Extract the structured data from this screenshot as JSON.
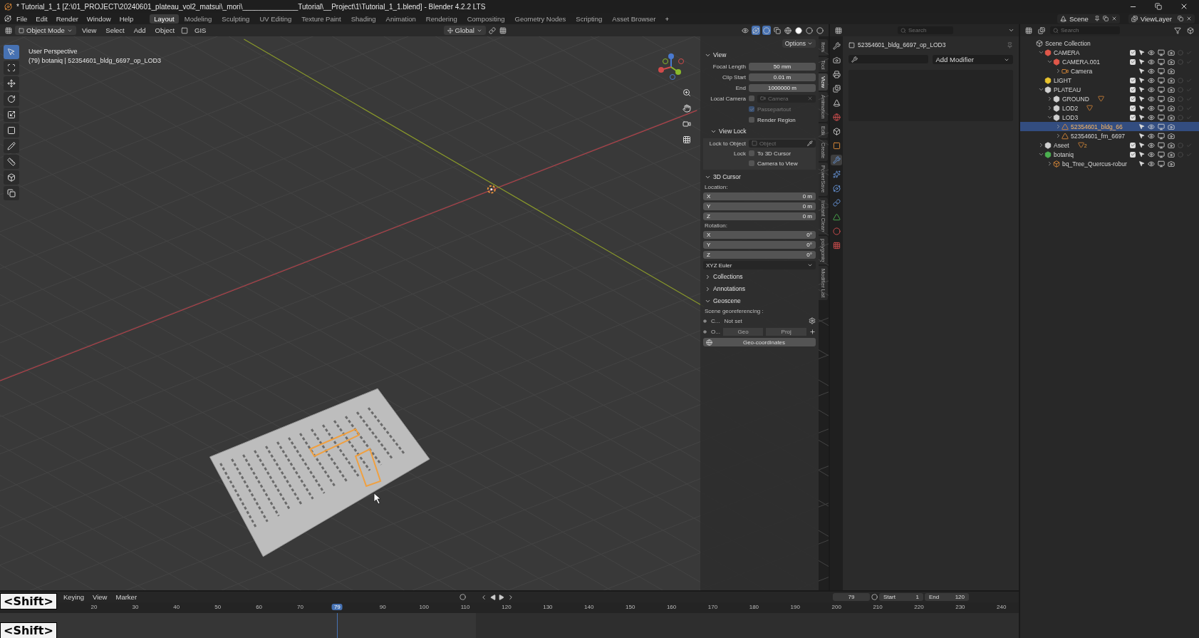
{
  "window": {
    "title": "* Tutorial_1_1 [Z:\\01_PROJECT\\20240601_plateau_vol2_matsui\\_mori\\______________Tutorial\\__Project\\1\\Tutorial_1_1.blend] - Blender 4.2.2 LTS"
  },
  "menus": [
    "File",
    "Edit",
    "Render",
    "Window",
    "Help"
  ],
  "workspaces": [
    {
      "label": "Layout",
      "selected": true
    },
    {
      "label": "Modeling",
      "selected": false
    },
    {
      "label": "Sculpting",
      "selected": false
    },
    {
      "label": "UV Editing",
      "selected": false
    },
    {
      "label": "Texture Paint",
      "selected": false
    },
    {
      "label": "Shading",
      "selected": false
    },
    {
      "label": "Animation",
      "selected": false
    },
    {
      "label": "Rendering",
      "selected": false
    },
    {
      "label": "Compositing",
      "selected": false
    },
    {
      "label": "Geometry Nodes",
      "selected": false
    },
    {
      "label": "Scripting",
      "selected": false
    },
    {
      "label": "Asset Browser",
      "selected": false
    }
  ],
  "add_workspace": "+",
  "scene": "Scene",
  "view_layer": "ViewLayer",
  "viewport": {
    "mode": "Object Mode",
    "menus": [
      "View",
      "Select",
      "Add",
      "Object"
    ],
    "gis": "GIS",
    "orientation": "Global",
    "options": "Options",
    "perspective": "User Perspective",
    "info": "(79) botaniq | 52354601_bldg_6697_op_LOD3"
  },
  "n_panel": {
    "view": {
      "title": "View",
      "expanded": true,
      "fields": [
        {
          "label": "Focal Length",
          "value": "50 mm"
        },
        {
          "label": "Clip Start",
          "value": "0.01 m"
        },
        {
          "label": "End",
          "value": "1000000 m"
        }
      ],
      "local_camera": {
        "label": "Local Camera",
        "checked": false,
        "placeholder": "Camera"
      },
      "passepartout": {
        "label": "Passepartout",
        "checked": true,
        "disabled": true
      },
      "render_region": {
        "label": "Render Region",
        "checked": false
      }
    },
    "view_lock": {
      "title": "View Lock",
      "expanded": true,
      "lock_to_object": "Lock to Object",
      "placeholder": "Object",
      "lock": "Lock",
      "options": [
        {
          "label": "To 3D Cursor",
          "checked": false
        },
        {
          "label": "Camera to View",
          "checked": false
        }
      ]
    },
    "cursor": {
      "title": "3D Cursor",
      "expanded": true,
      "location": "Location:",
      "location_rows": [
        {
          "axis": "X",
          "value": "0 m"
        },
        {
          "axis": "Y",
          "value": "0 m"
        },
        {
          "axis": "Z",
          "value": "0 m"
        }
      ],
      "rotation": "Rotation:",
      "rotation_rows": [
        {
          "axis": "X",
          "value": "0°"
        },
        {
          "axis": "Y",
          "value": "0°"
        },
        {
          "axis": "Z",
          "value": "0°"
        }
      ],
      "rotation_mode": "XYZ Euler"
    },
    "collections": {
      "title": "Collections",
      "expanded": false
    },
    "annotations": {
      "title": "Annotations",
      "expanded": false
    },
    "geoscene": {
      "title": "Geoscene",
      "expanded": true,
      "heading": "Scene georeferencing :",
      "crs_label": "C...",
      "crs_value": "Not set",
      "origin_label": "O...",
      "geo": "Geo",
      "proj": "Proj",
      "button": "Geo-coordinates"
    }
  },
  "n_tabs": [
    {
      "label": "Item",
      "selected": false
    },
    {
      "label": "Tool",
      "selected": false
    },
    {
      "label": "View",
      "selected": true
    },
    {
      "label": "Animation",
      "selected": false
    },
    {
      "label": "Edit",
      "selected": false
    },
    {
      "label": "Create",
      "selected": false
    },
    {
      "label": "PowerSave",
      "selected": false
    },
    {
      "label": "Instant Clean",
      "selected": false
    },
    {
      "label": "polygoniq",
      "selected": false
    },
    {
      "label": "Modifier List",
      "selected": false
    }
  ],
  "properties": {
    "search": {
      "placeholder": "Search"
    },
    "object_name": "52354601_bldg_6697_op_LOD3",
    "add_modifier": "Add Modifier",
    "tabs": [
      {
        "kind": "tool",
        "selected": false
      },
      {
        "kind": "render",
        "selected": false
      },
      {
        "kind": "output",
        "selected": false
      },
      {
        "kind": "viewlayer",
        "selected": false
      },
      {
        "kind": "scene",
        "selected": false
      },
      {
        "kind": "world",
        "selected": false
      },
      {
        "kind": "collection",
        "selected": false
      },
      {
        "kind": "object",
        "selected": false
      },
      {
        "kind": "modifier",
        "selected": true
      },
      {
        "kind": "particles",
        "selected": false
      },
      {
        "kind": "physics",
        "selected": false
      },
      {
        "kind": "constraints",
        "selected": false
      },
      {
        "kind": "data",
        "selected": false
      },
      {
        "kind": "material",
        "selected": false
      },
      {
        "kind": "texture",
        "selected": false
      }
    ]
  },
  "outliner": {
    "search": {
      "placeholder": "Search"
    },
    "items": [
      {
        "name": "Scene Collection",
        "kind": "scene",
        "selected": false,
        "children": [
          {
            "name": "CAMERA",
            "kind": "collection",
            "color": "#e0584a",
            "checked": true,
            "expanded": true,
            "selected": false,
            "children": [
              {
                "name": "CAMERA.001",
                "kind": "collection",
                "color": "#e0584a",
                "checked": true,
                "expanded": true,
                "selected": false,
                "children": [
                  {
                    "name": "Camera",
                    "kind": "camera",
                    "expanded": false,
                    "selected": false
                  }
                ]
              }
            ]
          },
          {
            "name": "LIGHT",
            "kind": "collection",
            "color": "#e8c32e",
            "checked": true,
            "selected": false
          },
          {
            "name": "PLATEAU",
            "kind": "collection",
            "color": "#d0d0d0",
            "checked": true,
            "expanded": true,
            "selected": false,
            "children": [
              {
                "name": "GROUND",
                "kind": "collection",
                "color": "#d0d0d0",
                "checked": true,
                "expanded": false,
                "mesh_hint": true,
                "selected": false
              },
              {
                "name": "LOD2",
                "kind": "collection",
                "color": "#d0d0d0",
                "checked": true,
                "expanded": false,
                "mesh_hint": true,
                "selected": false
              },
              {
                "name": "LOD3",
                "kind": "collection",
                "color": "#d0d0d0",
                "checked": true,
                "expanded": true,
                "selected": false,
                "children": [
                  {
                    "name": "52354601_bldg_66",
                    "kind": "mesh",
                    "expanded": false,
                    "selected": true
                  },
                  {
                    "name": "52354601_frn_6697",
                    "kind": "mesh",
                    "expanded": false,
                    "selected": false
                  }
                ]
              }
            ]
          },
          {
            "name": "Aseet",
            "kind": "collection",
            "color": "#d0d0d0",
            "checked": true,
            "expanded": false,
            "mesh_hint": true,
            "mesh_count": "2",
            "selected": false
          },
          {
            "name": "botaniq",
            "kind": "collection",
            "color": "#4cb050",
            "checked": true,
            "expanded": true,
            "selected": false,
            "children": [
              {
                "name": "bq_Tree_Quercus-robur",
                "kind": "instance",
                "expanded": false,
                "selected": false
              }
            ]
          }
        ]
      }
    ]
  },
  "timeline": {
    "menus": [
      "Keying",
      "View",
      "Marker"
    ],
    "current_frame": "79",
    "start_label": "Start",
    "start": "1",
    "end_label": "End",
    "end": "120",
    "ticks_before": [
      "20",
      "30",
      "40",
      "50",
      "60",
      "70"
    ],
    "ticks_after": [
      "90",
      "100",
      "110",
      "120",
      "130",
      "140",
      "150",
      "160",
      "170",
      "180",
      "190",
      "200",
      "210",
      "220",
      "230",
      "240"
    ],
    "playhead": {
      "label": "79",
      "level": 0.331
    },
    "range_end": {
      "level": 0.467
    }
  },
  "key_overlays": [
    "<Shift>",
    "<Shift>"
  ]
}
